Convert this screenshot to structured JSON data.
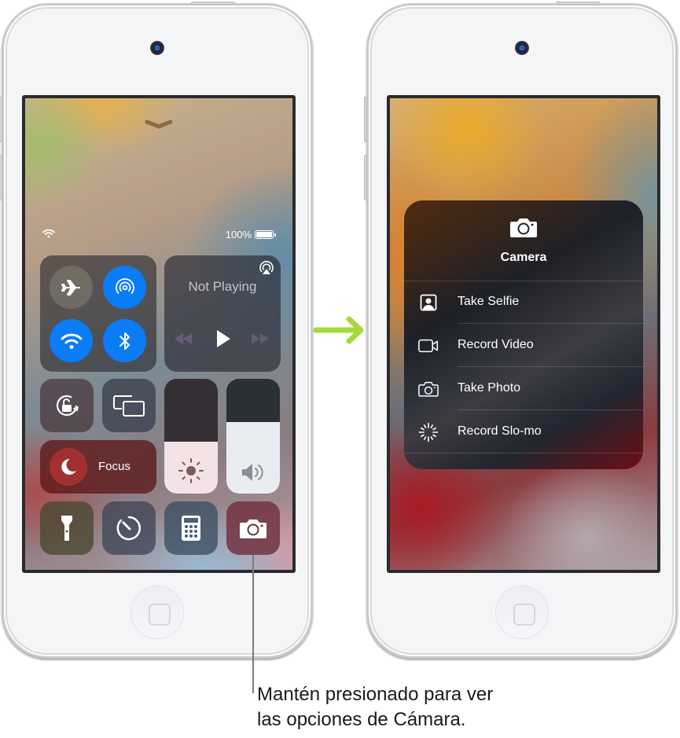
{
  "control_center": {
    "status_bar": {
      "wifi_icon": "wifi-icon",
      "battery_percent": "100%"
    },
    "connectivity": {
      "airplane_mode": {
        "icon": "airplane-icon",
        "state": "off"
      },
      "airdrop": {
        "icon": "airdrop-icon",
        "state": "on"
      },
      "wifi": {
        "icon": "wifi-icon",
        "state": "on"
      },
      "bluetooth": {
        "icon": "bluetooth-icon",
        "state": "on"
      }
    },
    "media": {
      "title": "Not Playing",
      "airplay_icon": "airplay-icon"
    },
    "focus": {
      "label": "Focus",
      "icon": "moon-icon"
    },
    "brightness_level": 0.45,
    "volume_level": 0.62,
    "tiles": [
      "orientation-lock",
      "screen-mirroring",
      "flashlight",
      "timer",
      "calculator",
      "camera"
    ]
  },
  "camera_menu": {
    "title": "Camera",
    "items": [
      {
        "label": "Take Selfie",
        "icon": "selfie-icon"
      },
      {
        "label": "Record Video",
        "icon": "video-icon"
      },
      {
        "label": "Take Photo",
        "icon": "camera-icon"
      },
      {
        "label": "Record Slo-mo",
        "icon": "slomo-icon"
      }
    ]
  },
  "colors": {
    "accent_blue": "#0a7cf6",
    "arrow_green": "#a6d93c",
    "focus_red": "#a33030"
  },
  "callout": {
    "line1": "Mantén presionado para ver",
    "line2": "las opciones de Cámara."
  }
}
